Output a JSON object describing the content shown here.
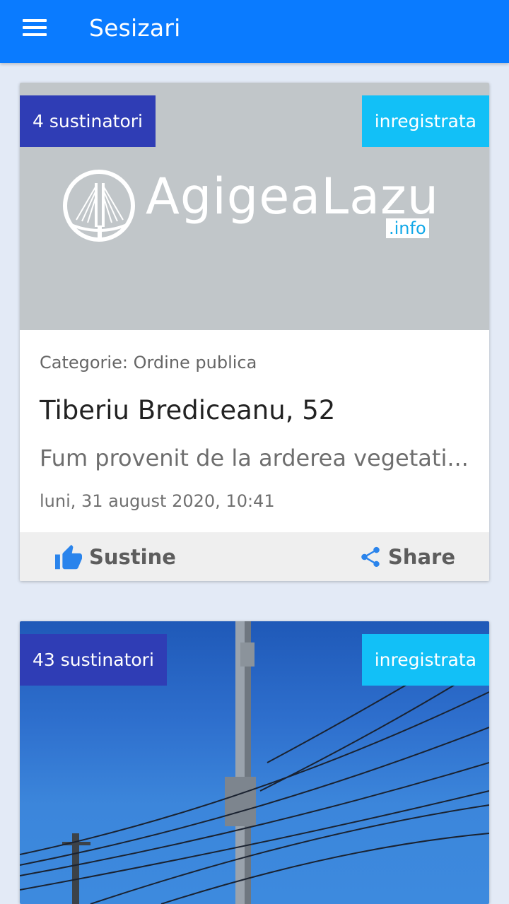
{
  "appbar": {
    "title": "Sesizari",
    "menu_icon": "hamburger-menu-icon"
  },
  "colors": {
    "appbar": "#0a7bff",
    "background": "#e3eaf6",
    "badge_count": "#2f3db5",
    "badge_status": "#12c0f7",
    "icon_blue": "#2a84ec"
  },
  "cards": [
    {
      "supporters": "4 sustinatori",
      "status": "inregistrata",
      "image_logo": {
        "text": "AgigeaLazu",
        "sub": ".info"
      },
      "category": "Categorie: Ordine publica",
      "title": "Tiberiu Brediceanu, 52",
      "description": "Fum provenit de la arderea vegetati...",
      "date": "luni, 31 august 2020, 10:41",
      "actions": {
        "support_label": "Sustine",
        "share_label": "Share"
      }
    },
    {
      "supporters": "43 sustinatori",
      "status": "inregistrata"
    }
  ]
}
